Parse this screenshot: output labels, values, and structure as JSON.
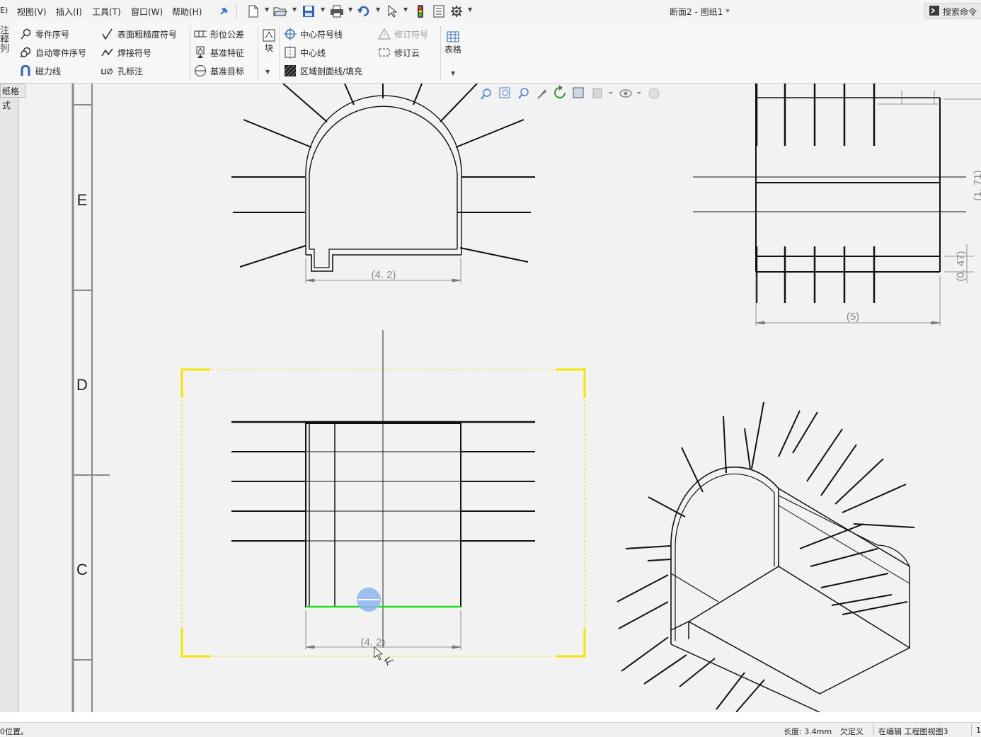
{
  "menubar": {
    "items": [
      "E)",
      "视图(V)",
      "插入(I)",
      "工具(T)",
      "窗口(W)",
      "帮助(H)"
    ],
    "document_title": "断面2 - 图纸1 *",
    "search_label": "搜索命令"
  },
  "ribbon": {
    "left_stub": [
      "注",
      "释",
      "列"
    ],
    "col1": [
      "零件序号",
      "自动零件序号",
      "磁力线"
    ],
    "col2": [
      "表面粗糙度符号",
      "焊接符号",
      "孔标注"
    ],
    "col3": [
      "形位公差",
      "基准特征",
      "基准目标"
    ],
    "block_label": "块",
    "col4": [
      "中心符号线",
      "中心线",
      "区域剖面线/填充"
    ],
    "col5": [
      "修订符号",
      "修订云"
    ],
    "table_label": "表格"
  },
  "side_tab": "纸格式",
  "zone_letters": [
    "E",
    "D",
    "C"
  ],
  "dimensions": {
    "top_view_width": "(4. 2)",
    "front_view_width": "(4. 2)",
    "side_view_width": "(5)",
    "side_view_height": "(0. 47)",
    "side_view_partial": "(1. 71)"
  },
  "statusbar": {
    "left": "0位置。",
    "length": "长度: 3.4mm",
    "state": "欠定义",
    "mode": "在编辑 工程图视图3",
    "page": "1"
  },
  "colors": {
    "selection_box": "#f2e600",
    "selected_edge": "#22dd22",
    "canvas": "#f2f2f2",
    "line": "#111111"
  }
}
